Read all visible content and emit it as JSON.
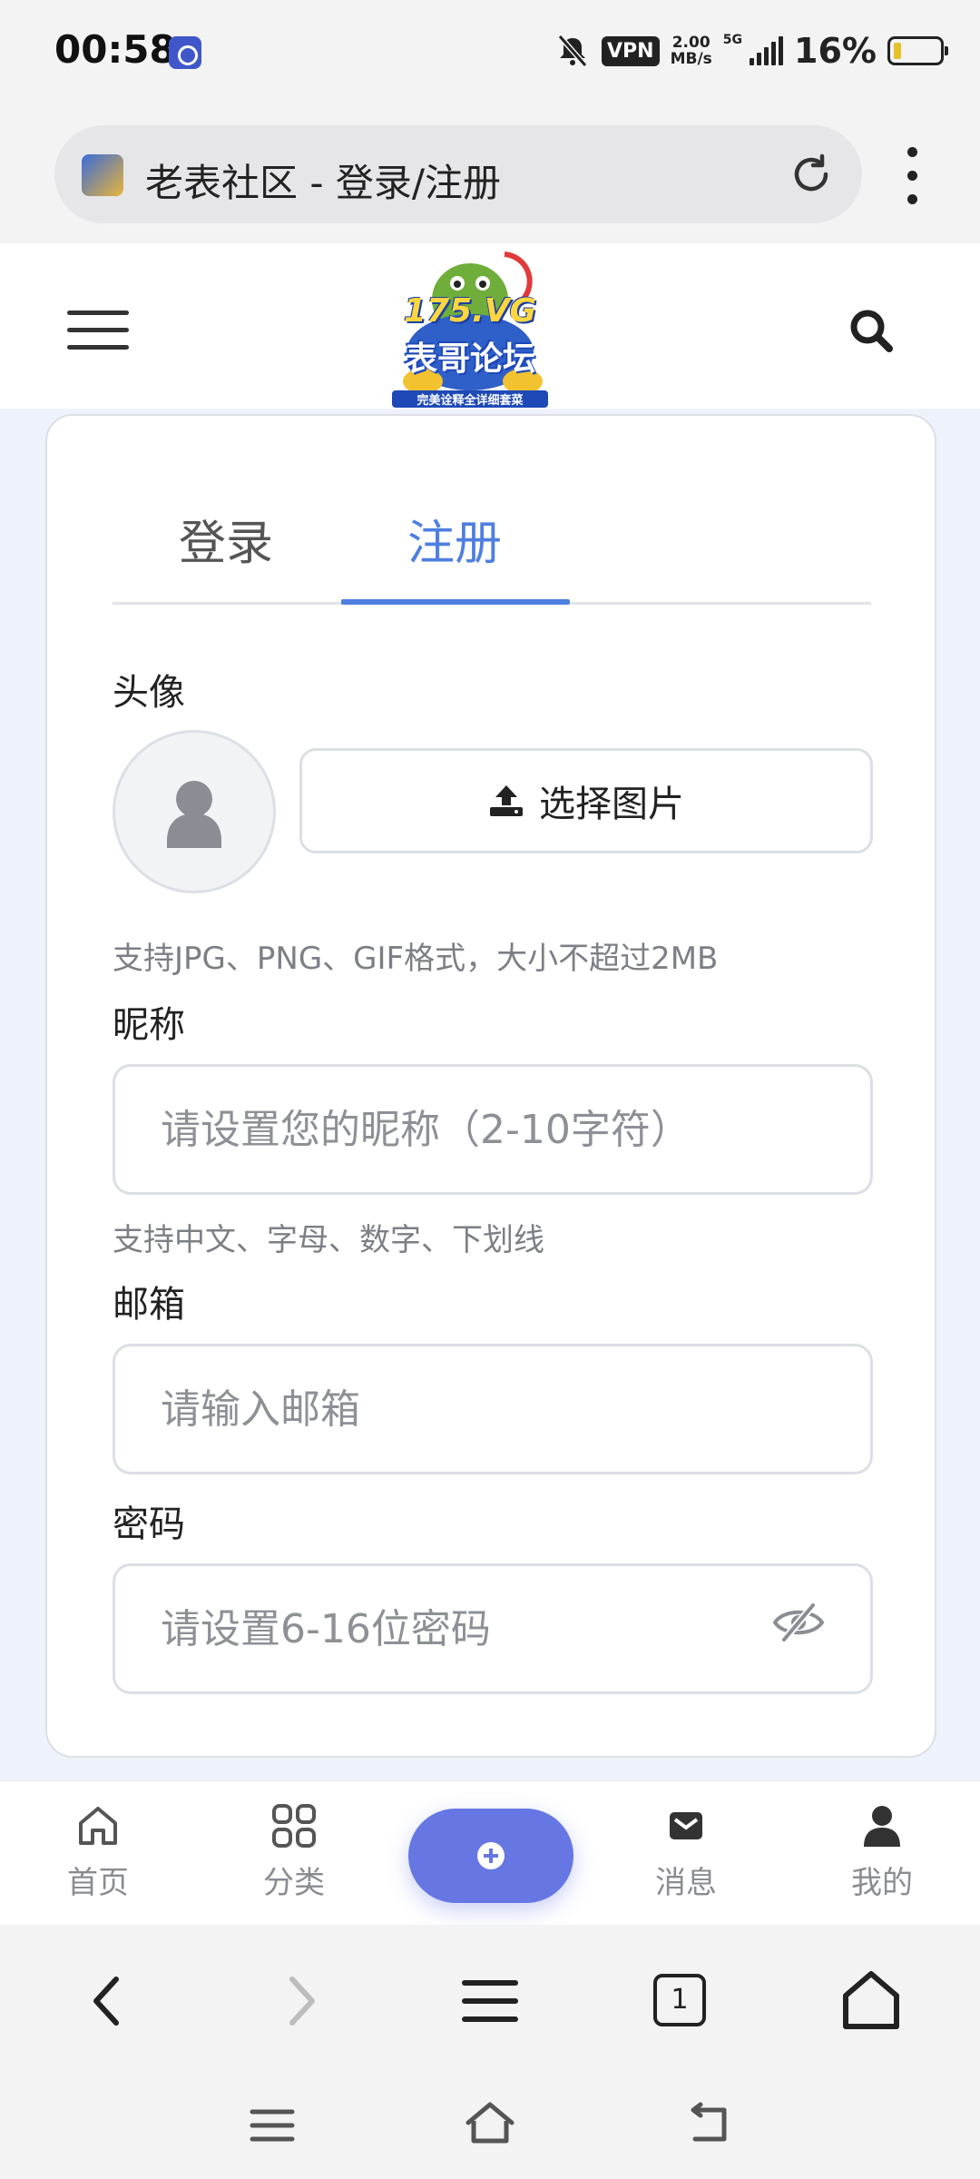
{
  "status_bar": {
    "time": "00:58",
    "vpn": "VPN",
    "net_speed_value": "2.00",
    "net_speed_unit": "MB/s",
    "network_type": "5G",
    "battery_percent": "16%"
  },
  "browser": {
    "page_title": "老表社区 - 登录/注册",
    "tab_count": "1"
  },
  "header": {
    "logo_number": "175.VG",
    "logo_name": "表哥论坛",
    "logo_tagline": "完美诠释全详细套菜"
  },
  "auth": {
    "tabs": [
      {
        "label": "登录",
        "active": false
      },
      {
        "label": "注册",
        "active": true
      }
    ],
    "avatar": {
      "label": "头像",
      "upload_label": "选择图片",
      "hint": "支持JPG、PNG、GIF格式，大小不超过2MB"
    },
    "nickname": {
      "label": "昵称",
      "placeholder": "请设置您的昵称（2-10字符）",
      "hint": "支持中文、字母、数字、下划线"
    },
    "email": {
      "label": "邮箱",
      "placeholder": "请输入邮箱"
    },
    "password": {
      "label": "密码",
      "placeholder": "请设置6-16位密码"
    }
  },
  "bottom_nav": {
    "items": [
      {
        "label": "首页",
        "icon": "home-icon"
      },
      {
        "label": "分类",
        "icon": "grid-icon"
      },
      {
        "label": "消息",
        "icon": "envelope-icon"
      },
      {
        "label": "我的",
        "icon": "user-icon"
      }
    ]
  },
  "colors": {
    "accent": "#4e7fe0",
    "fab": "#6677e3"
  }
}
